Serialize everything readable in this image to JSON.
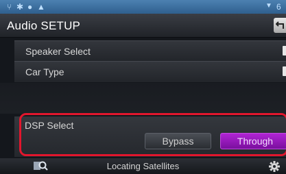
{
  "status_bar": {
    "icons": [
      "usb-icon",
      "bluetooth-icon",
      "message-icon",
      "warning-icon"
    ],
    "right_text": "6"
  },
  "header": {
    "title": "Audio SETUP",
    "back_icon": "back-arrow-icon"
  },
  "list": {
    "items": [
      {
        "label": "Speaker Select"
      },
      {
        "label": "Car Type"
      }
    ]
  },
  "dsp": {
    "label": "DSP Select",
    "options": [
      {
        "label": "Bypass",
        "selected": false
      },
      {
        "label": "Through",
        "selected": true
      }
    ]
  },
  "bottom_bar": {
    "status_text": "Locating Satellites",
    "left_icon": "navigation-search-icon",
    "right_icon": "gear-icon"
  },
  "colors": {
    "status_bar": "#3d6f9f",
    "selected_button": "#a21cc8",
    "highlight_border": "#e2162d"
  }
}
